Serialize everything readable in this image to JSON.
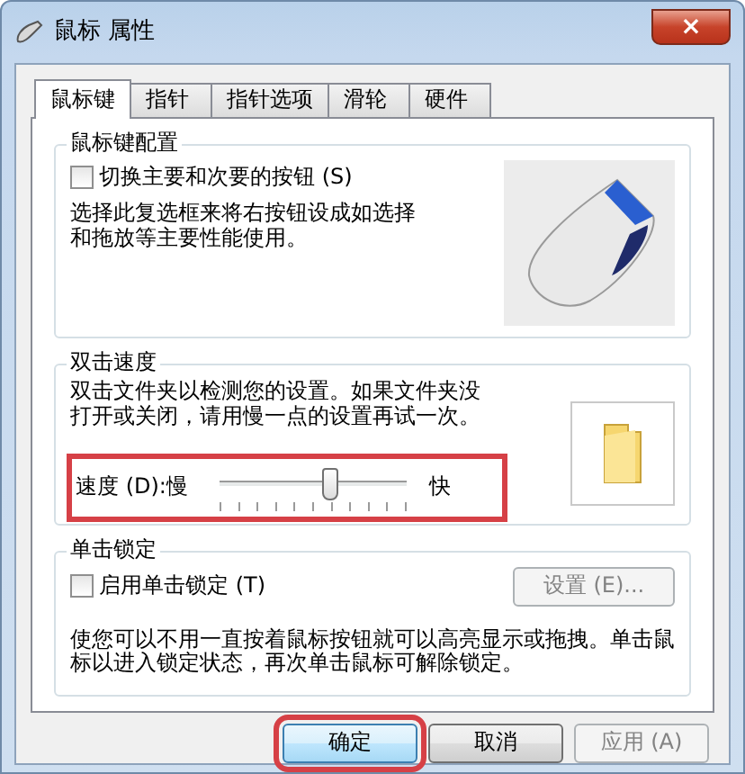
{
  "window": {
    "title": "鼠标 属性",
    "close": "×"
  },
  "tabs": [
    {
      "label": "鼠标键",
      "selected": true
    },
    {
      "label": "指针",
      "selected": false
    },
    {
      "label": "指针选项",
      "selected": false
    },
    {
      "label": "滑轮",
      "selected": false
    },
    {
      "label": "硬件",
      "selected": false
    }
  ],
  "button_config": {
    "title": "鼠标键配置",
    "checkbox": {
      "label": "切换主要和次要的按钮 (S)",
      "checked": false
    },
    "description": "选择此复选框来将右按钮设成如选择和拖放等主要性能使用。"
  },
  "double_click": {
    "title": "双击速度",
    "description": "双击文件夹以检测您的设置。如果文件夹没打开或关闭，请用慢一点的设置再试一次。",
    "speed_label": "速度 (D):",
    "slow": "慢",
    "fast": "快",
    "level": 0.58,
    "highlighted": true
  },
  "click_lock": {
    "title": "单击锁定",
    "checkbox": {
      "label": "启用单击锁定 (T)",
      "checked": false
    },
    "settings_button": {
      "label": "设置 (E)...",
      "disabled": true
    },
    "description": "使您可以不用一直按着鼠标按钮就可以高亮显示或拖拽。单击鼠标以进入锁定状态，再次单击鼠标可解除锁定。"
  },
  "buttons": [
    {
      "label": "确定",
      "disabled": false,
      "highlighted": true
    },
    {
      "label": "取消",
      "disabled": false,
      "highlighted": false
    },
    {
      "label": "应用 (A)",
      "disabled": true,
      "highlighted": false
    }
  ]
}
